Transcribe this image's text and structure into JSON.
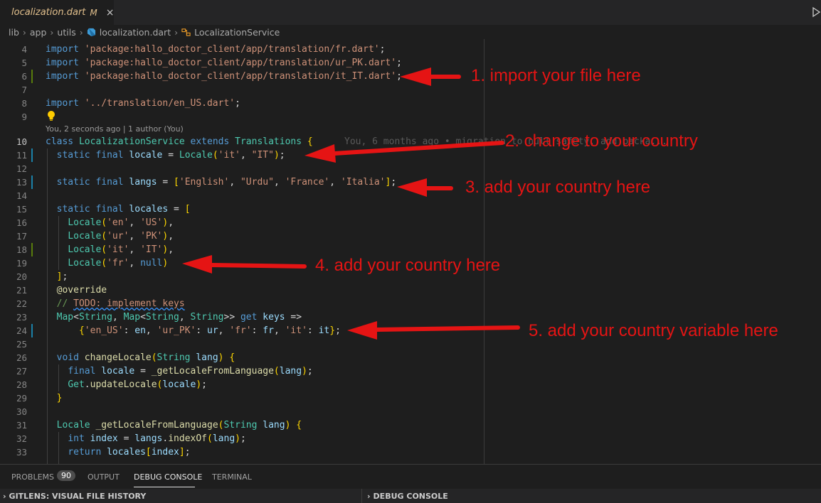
{
  "tab": {
    "filename": "localization.dart",
    "modified_marker": "M",
    "close_glyph": "×"
  },
  "breadcrumb": {
    "items": [
      "lib",
      "app",
      "utils",
      "localization.dart",
      "LocalizationService"
    ]
  },
  "editor": {
    "codelens": "You, 2 seconds ago | 1 author (You)",
    "inline_blame": "You, 6 months ago • migration to null safety, add packa...",
    "lines": [
      {
        "n": 4,
        "code": "import 'package:hallo_doctor_client/app/translation/fr.dart';"
      },
      {
        "n": 5,
        "code": "import 'package:hallo_doctor_client/app/translation/ur_PK.dart';"
      },
      {
        "n": 6,
        "code": "import 'package:hallo_doctor_client/app/translation/it_IT.dart';"
      },
      {
        "n": 7,
        "code": ""
      },
      {
        "n": 8,
        "code": "import '../translation/en_US.dart';"
      },
      {
        "n": 9,
        "code": ""
      },
      {
        "n": 10,
        "code": "class LocalizationService extends Translations {"
      },
      {
        "n": 11,
        "code": "  static final locale = Locale('it', \"IT\");"
      },
      {
        "n": 12,
        "code": ""
      },
      {
        "n": 13,
        "code": "  static final langs = ['English', \"Urdu\", 'France', 'Italia'];"
      },
      {
        "n": 14,
        "code": ""
      },
      {
        "n": 15,
        "code": "  static final locales = ["
      },
      {
        "n": 16,
        "code": "    Locale('en', 'US'),"
      },
      {
        "n": 17,
        "code": "    Locale('ur', 'PK'),"
      },
      {
        "n": 18,
        "code": "    Locale('it', 'IT'),"
      },
      {
        "n": 19,
        "code": "    Locale('fr', null)"
      },
      {
        "n": 20,
        "code": "  ];"
      },
      {
        "n": 21,
        "code": "  @override"
      },
      {
        "n": 22,
        "code": "  // TODO: implement keys"
      },
      {
        "n": 23,
        "code": "  Map<String, Map<String, String>> get keys =>"
      },
      {
        "n": 24,
        "code": "      {'en_US': en, 'ur_PK': ur, 'fr': fr, 'it': it};"
      },
      {
        "n": 25,
        "code": ""
      },
      {
        "n": 26,
        "code": "  void changeLocale(String lang) {"
      },
      {
        "n": 27,
        "code": "    final locale = _getLocaleFromLanguage(lang);"
      },
      {
        "n": 28,
        "code": "    Get.updateLocale(locale);"
      },
      {
        "n": 29,
        "code": "  }"
      },
      {
        "n": 30,
        "code": ""
      },
      {
        "n": 31,
        "code": "  Locale _getLocaleFromLanguage(String lang) {"
      },
      {
        "n": 32,
        "code": "    int index = langs.indexOf(lang);"
      },
      {
        "n": 33,
        "code": "    return locales[index];"
      }
    ]
  },
  "annotations": [
    "1. import your file here",
    "2. change to your country",
    "3. add your country here",
    "4. add your country here",
    "5. add your country variable here"
  ],
  "panel": {
    "tabs": [
      "PROBLEMS",
      "OUTPUT",
      "DEBUG CONSOLE",
      "TERMINAL"
    ],
    "problems_count": "90",
    "active_tab": "DEBUG CONSOLE"
  },
  "bottom": {
    "left_section": "GITLENS: VISUAL FILE HISTORY",
    "right_section": "DEBUG CONSOLE"
  },
  "colors": {
    "annotation": "#e51414",
    "editor_bg": "#1e1e1e"
  }
}
